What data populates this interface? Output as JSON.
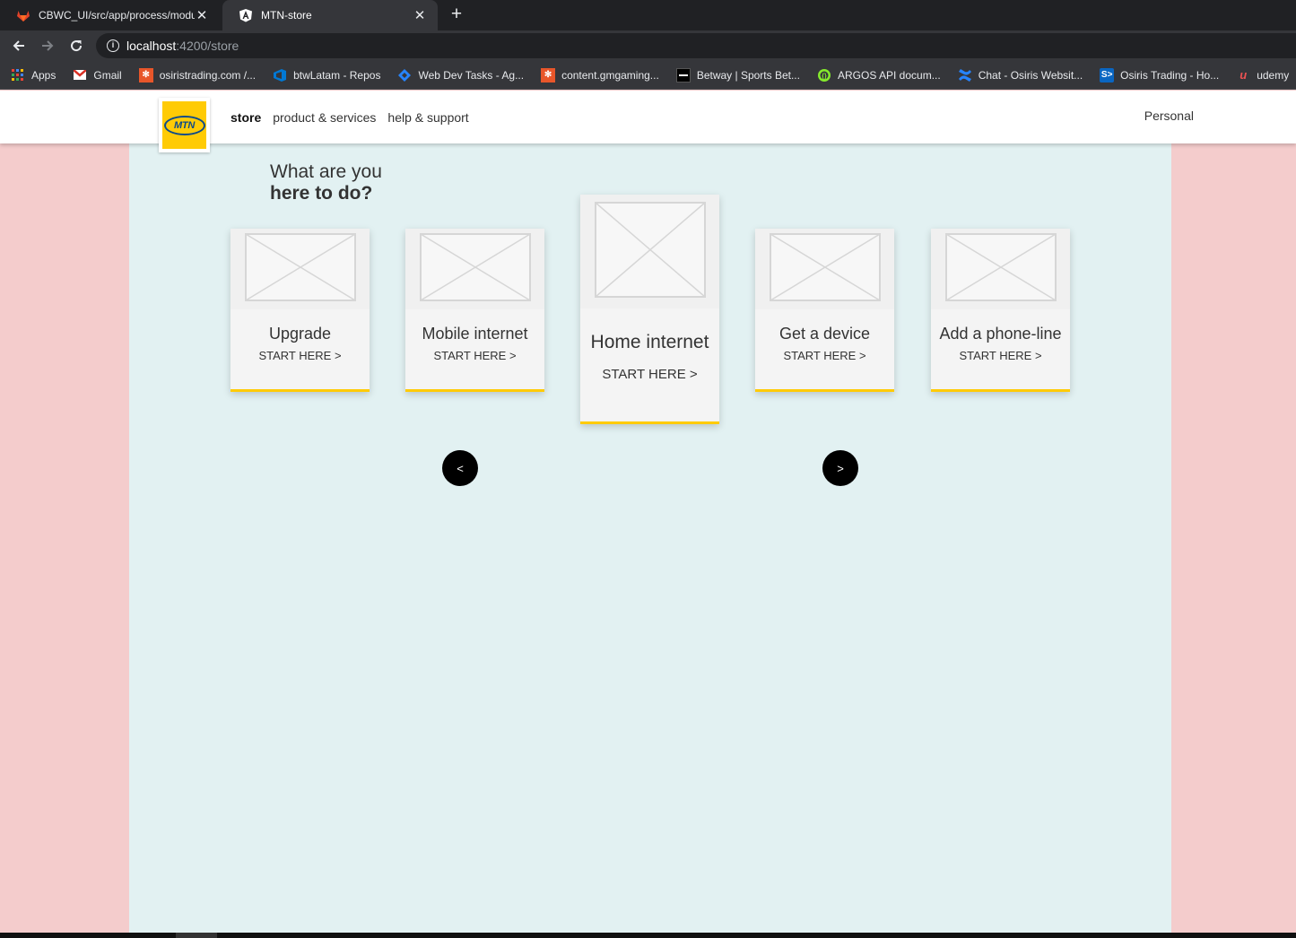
{
  "browser": {
    "tabs": [
      {
        "title": "CBWC_UI/src/app/process/modu",
        "icon": "gitlab-icon",
        "active": false
      },
      {
        "title": "MTN-store",
        "icon": "angular-icon",
        "active": true
      }
    ],
    "address": {
      "host": "localhost",
      "path": ":4200/store"
    },
    "bookmarks": [
      {
        "label": "Apps",
        "icon": "apps-grid-icon"
      },
      {
        "label": "Gmail",
        "icon": "gmail-icon"
      },
      {
        "label": "osiristrading.com /...",
        "icon": "orange-star-icon"
      },
      {
        "label": "btwLatam - Repos",
        "icon": "azure-devops-icon"
      },
      {
        "label": "Web Dev Tasks - Ag...",
        "icon": "jira-icon"
      },
      {
        "label": "content.gmgaming...",
        "icon": "orange-star-icon"
      },
      {
        "label": "Betway | Sports Bet...",
        "icon": "betway-icon"
      },
      {
        "label": "ARGOS API docum...",
        "icon": "argos-icon"
      },
      {
        "label": "Chat - Osiris Websit...",
        "icon": "confluence-icon"
      },
      {
        "label": "Osiris Trading - Ho...",
        "icon": "osiris-icon"
      },
      {
        "label": "udemy",
        "icon": "udemy-icon"
      }
    ]
  },
  "header": {
    "logo_text": "MTN",
    "nav": [
      "store",
      "product & services",
      "help & support"
    ],
    "personal": "Personal"
  },
  "main": {
    "heading_line1": "What are you",
    "heading_line2": "here to do?",
    "cards": [
      {
        "title": "Upgrade",
        "cta": "START HERE >",
        "featured": false
      },
      {
        "title": "Mobile internet",
        "cta": "START HERE >",
        "featured": false
      },
      {
        "title": "Home internet",
        "cta": "START HERE >",
        "featured": true
      },
      {
        "title": "Get a device",
        "cta": "START HERE >",
        "featured": false
      },
      {
        "title": "Add a phone-line",
        "cta": "START HERE >",
        "featured": false
      }
    ],
    "prev_label": "<",
    "next_label": ">"
  },
  "colors": {
    "side_background": "#f4cccc",
    "main_background": "#e2f1f2",
    "accent_yellow": "#ffcb05",
    "mtn_blue": "#0d4a8a"
  }
}
